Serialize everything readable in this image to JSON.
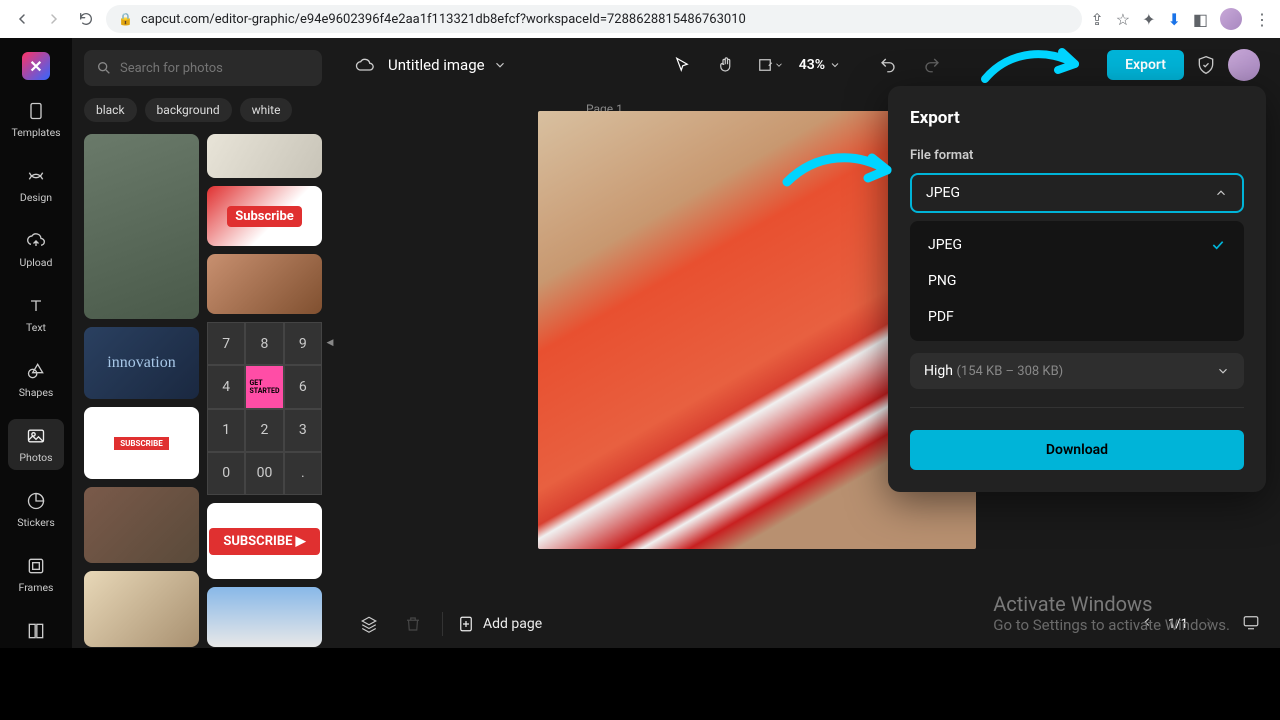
{
  "browser": {
    "url": "capcut.com/editor-graphic/e94e9602396f4e2aa1f113321db8efcf?workspaceId=7288628815486763010"
  },
  "rail": {
    "items": [
      {
        "label": "Templates"
      },
      {
        "label": "Design"
      },
      {
        "label": "Upload"
      },
      {
        "label": "Text"
      },
      {
        "label": "Shapes"
      },
      {
        "label": "Photos"
      },
      {
        "label": "Stickers"
      },
      {
        "label": "Frames"
      }
    ]
  },
  "panel": {
    "search_placeholder": "Search for photos",
    "chips": [
      "black",
      "background",
      "white"
    ],
    "innovation_text": "innovation"
  },
  "doc": {
    "title": "Untitled image",
    "zoom": "43%",
    "page_label": "Page 1"
  },
  "toolbar": {
    "export_label": "Export"
  },
  "export": {
    "title": "Export",
    "format_label": "File format",
    "selected_format": "JPEG",
    "options": [
      "JPEG",
      "PNG",
      "PDF"
    ],
    "quality_label": "High",
    "quality_detail": "(154 KB – 308 KB)",
    "download_label": "Download"
  },
  "bottombar": {
    "add_page": "Add page",
    "page_indicator": "1/1"
  },
  "watermark": {
    "line1": "Activate Windows",
    "line2": "Go to Settings to activate Windows."
  }
}
